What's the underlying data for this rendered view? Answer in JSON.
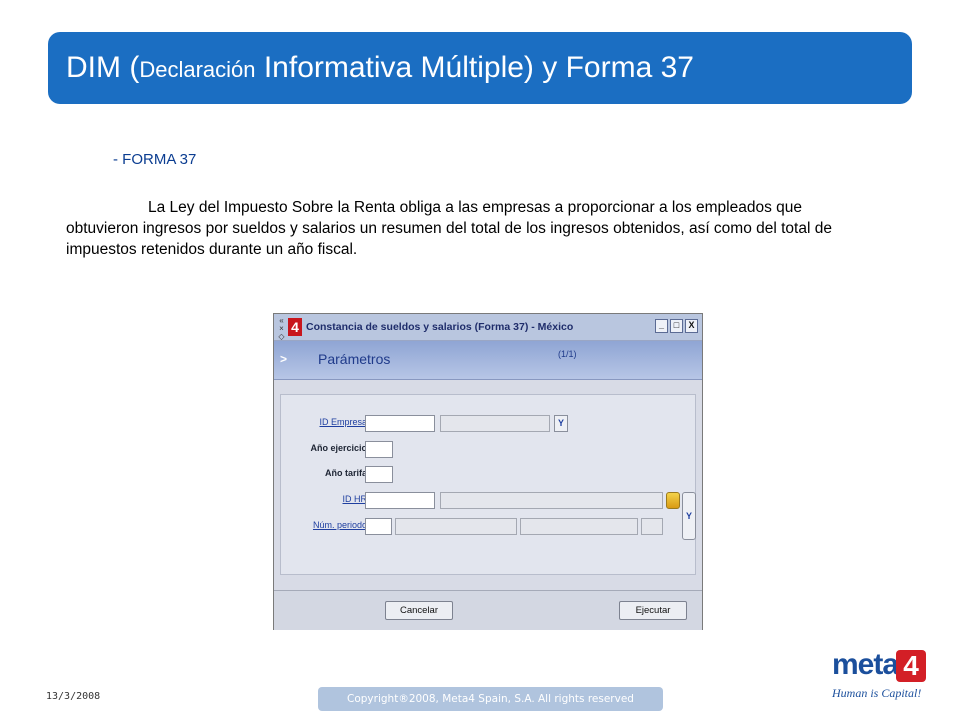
{
  "slide": {
    "title_prefix": "DIM (",
    "title_small": "Declaración",
    "title_rest": " Informativa Múltiple) y Forma 37",
    "section_heading": "- FORMA 37",
    "body": "La Ley del Impuesto Sobre la Renta obliga a las empresas a proporcionar a los empleados que obtuvieron ingresos por sueldos y salarios un resumen del total de los ingresos obtenidos, así como del total de impuestos retenidos durante un año fiscal.",
    "date": "13/3/2008",
    "copyright": "Copyright®2008, Meta4 Spain, S.A. All rights reserved"
  },
  "brand": {
    "name": "meta",
    "four": "4",
    "tagline": "Human is Capital!",
    "color": "#1b4f9c",
    "accent": "#d31f26"
  },
  "window": {
    "logo": "4",
    "side_controls": [
      "«",
      "×",
      "◇"
    ],
    "title": "Constancia de sueldos y salarios (Forma 37) - México",
    "buttons": {
      "minimize": "_",
      "maximize": "□",
      "close": "X"
    },
    "section": "Parámetros",
    "chevron": ">",
    "page_indicator": "(1/1)",
    "fields": {
      "id_empresa": {
        "label": "ID Empresa",
        "value": "",
        "description": ""
      },
      "anio_ejercicio": {
        "label": "Año ejercicio",
        "value": ""
      },
      "anio_tarifa": {
        "label": "Año tarifa",
        "value": ""
      },
      "id_hr": {
        "label": "ID HR",
        "value": "",
        "description": ""
      },
      "num_periodo": {
        "label": "Núm. periodo",
        "value": "",
        "value2": "",
        "value3": "",
        "value4": ""
      }
    },
    "lookup_label": "Y",
    "actions": {
      "cancel": "Cancelar",
      "execute": "Ejecutar"
    }
  }
}
